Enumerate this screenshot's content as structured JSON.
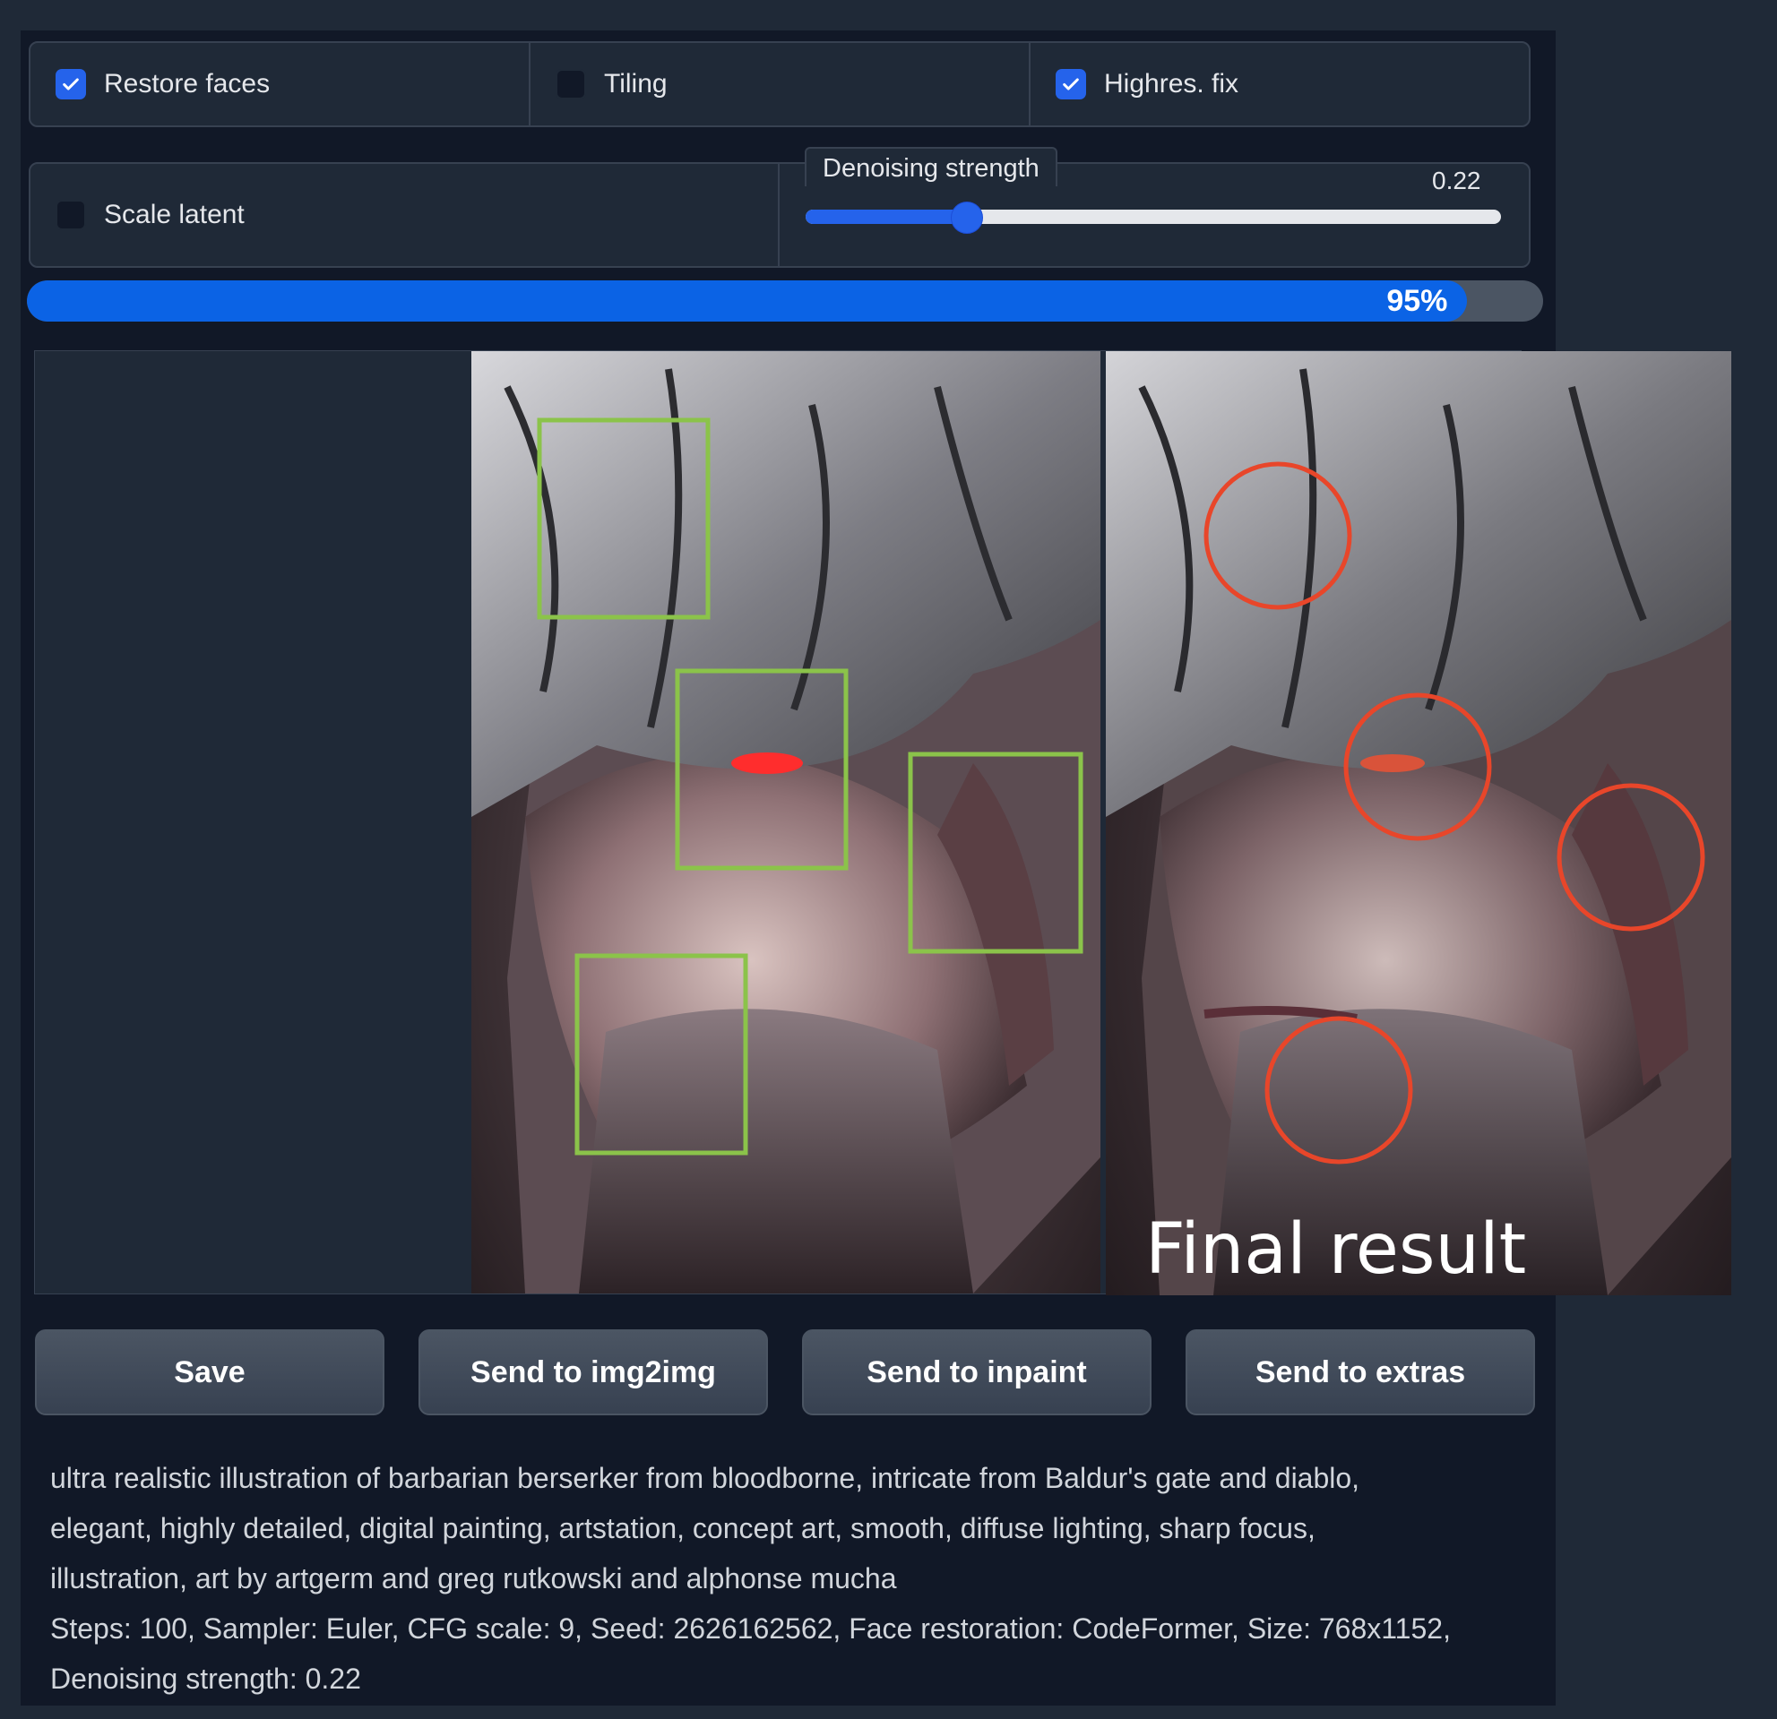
{
  "options": {
    "restore_faces": {
      "label": "Restore faces",
      "checked": true
    },
    "tiling": {
      "label": "Tiling",
      "checked": false
    },
    "highres_fix": {
      "label": "Highres. fix",
      "checked": true
    },
    "scale_latent": {
      "label": "Scale latent",
      "checked": false
    }
  },
  "denoising": {
    "label": "Denoising strength",
    "value": "0.22",
    "fraction": 0.22
  },
  "progress": {
    "text": "95%",
    "fraction": 0.95
  },
  "gallery": {
    "left_image_icon": "barbarian-portrait-image",
    "right_image_icon": "barbarian-portrait-image",
    "final_label": "Final result"
  },
  "buttons": {
    "save": "Save",
    "img2img": "Send to img2img",
    "inpaint": "Send to inpaint",
    "extras": "Send to extras"
  },
  "generation_info": {
    "line1": "ultra realistic illustration of barbarian berserker from bloodborne, intricate from Baldur's gate and diablo,",
    "line2": "elegant, highly detailed, digital painting, artstation, concept art, smooth, diffuse lighting, sharp focus,",
    "line3": "illustration, art by artgerm and greg rutkowski and alphonse mucha",
    "line4": "Steps: 100, Sampler: Euler, CFG scale: 9, Seed: 2626162562, Face restoration: CodeFormer, Size: 768x1152,",
    "line5": "Denoising strength: 0.22"
  },
  "colors": {
    "accent": "#2563eb",
    "annotation_box": "#8bc34a",
    "annotation_circle": "#e8462a"
  }
}
